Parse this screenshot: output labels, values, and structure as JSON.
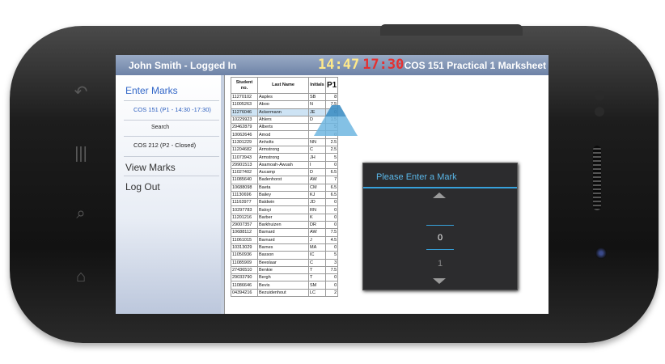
{
  "titlebar": {
    "user": "John Smith - Logged In",
    "time_current": "14:47",
    "time_end": "17:30",
    "course_title": "COS 151 Practical 1 Marksheet"
  },
  "sidebar": {
    "enter_marks": "Enter Marks",
    "sub_items": [
      {
        "label": "COS 151 (P1 - 14:30 -17:30)"
      },
      {
        "label": "Search"
      },
      {
        "label": "COS 212 (P2 - Closed)"
      }
    ],
    "view_marks": "View Marks",
    "log_out": "Log Out"
  },
  "sheet": {
    "headers": {
      "student_no": "Student no.",
      "last_name": "Last Name",
      "initials": "Initials",
      "mark": "P1"
    },
    "rows": [
      [
        "11270102",
        "Aaples",
        "SB",
        "8"
      ],
      [
        "11005263",
        "Aboo",
        "N",
        "7.5"
      ],
      [
        "11276046",
        "Ackermann",
        "JE",
        "0"
      ],
      [
        "10229923",
        "Ahlers",
        "D",
        "1.5"
      ],
      [
        "29462879",
        "Alberts",
        "",
        "5"
      ],
      [
        "10062646",
        "Amod",
        "",
        "0"
      ],
      [
        "11301229",
        "Anholts",
        "NN",
        "2.5"
      ],
      [
        "11204682",
        "Armstrong",
        "C",
        "2.5"
      ],
      [
        "11073943",
        "Armstrong",
        "JH",
        "5"
      ],
      [
        "29901513",
        "Asamoah-Awuah",
        "I",
        "0"
      ],
      [
        "11027402",
        "Aucamp",
        "D",
        "6.5"
      ],
      [
        "11085640",
        "Badenhorst",
        "AW",
        "7"
      ],
      [
        "10688098",
        "Baeta",
        "CM",
        "6.5"
      ],
      [
        "11130696",
        "Bailey",
        "KJ",
        "6.5"
      ],
      [
        "11163977",
        "Baldwin",
        "JD",
        "0"
      ],
      [
        "10297783",
        "Baloyi",
        "RN",
        "0"
      ],
      [
        "11201216",
        "Barber",
        "K",
        "0"
      ],
      [
        "29007357",
        "Barkhuizen",
        "DR",
        "0"
      ],
      [
        "10688112",
        "Barnard",
        "AW",
        "7.5"
      ],
      [
        "11061015",
        "Barnard",
        "J",
        "4.5"
      ],
      [
        "10313029",
        "Barnes",
        "MA",
        "0"
      ],
      [
        "11050936",
        "Basson",
        "IC",
        "5"
      ],
      [
        "11085909",
        "Beeslaar",
        "C",
        "3"
      ],
      [
        "27436510",
        "Benkie",
        "T",
        "7.5"
      ],
      [
        "29033790",
        "Bergh",
        "T",
        "0"
      ],
      [
        "11086646",
        "Bevis",
        "SM",
        "0"
      ],
      [
        "04394216",
        "Bezuidenhout",
        "LC",
        "2"
      ]
    ],
    "selected_row": 2
  },
  "dialog": {
    "title": "Please Enter a Mark",
    "value": "0",
    "next_value": "1"
  },
  "colors": {
    "accent": "#37a1db",
    "title_bar": "#7d90b1",
    "clock_end": "#e53030",
    "clock_current": "#ffe98a"
  }
}
